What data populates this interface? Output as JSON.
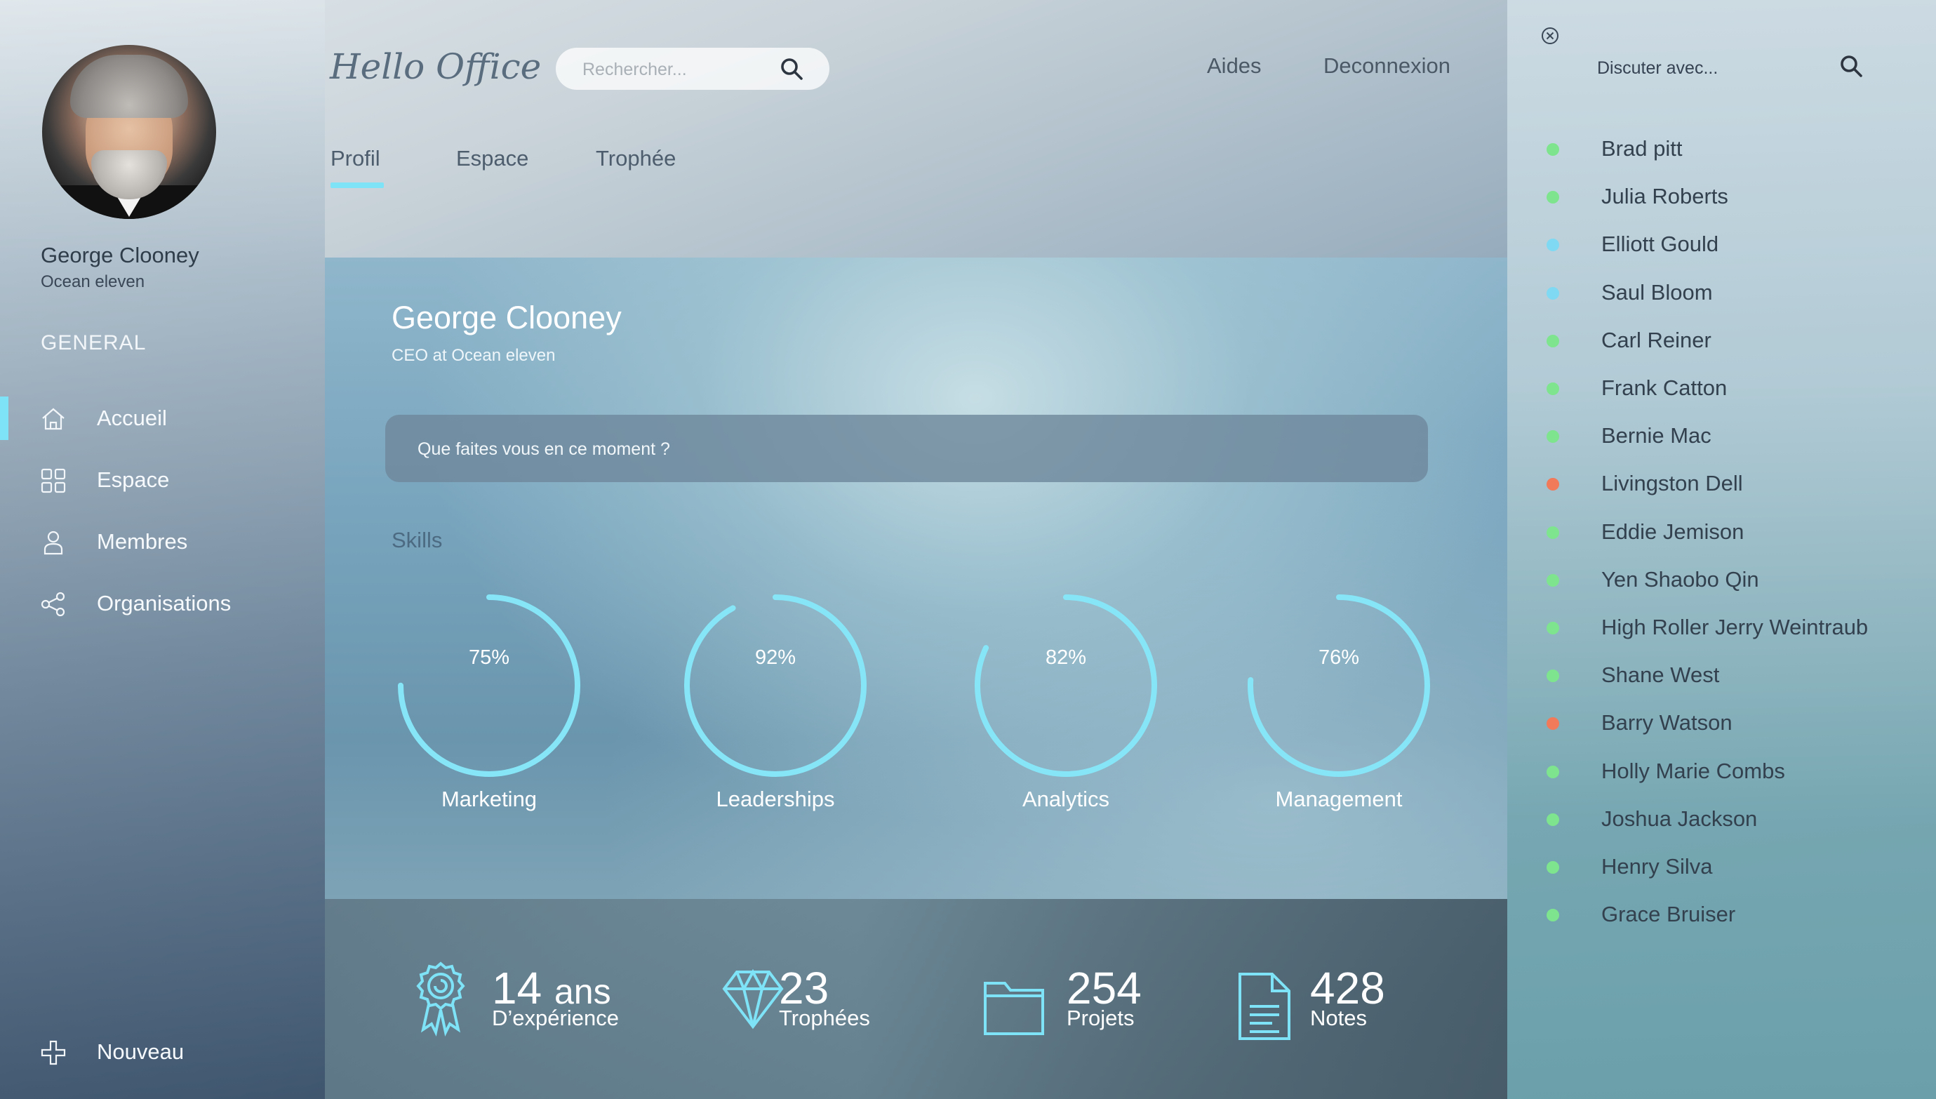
{
  "sidebar": {
    "user_name": "George Clooney",
    "user_sub": "Ocean eleven",
    "section_title": "GENERAL",
    "items": [
      {
        "label": "Accueil",
        "icon": "home-icon"
      },
      {
        "label": "Espace",
        "icon": "grid-icon"
      },
      {
        "label": "Membres",
        "icon": "user-icon"
      },
      {
        "label": "Organisations",
        "icon": "share-icon"
      }
    ],
    "new_label": "Nouveau"
  },
  "header": {
    "logo": "Hello Office",
    "search_placeholder": "Rechercher...",
    "help": "Aides",
    "logout": "Deconnexion",
    "tabs": [
      "Profil",
      "Espace",
      "Trophée"
    ]
  },
  "profile": {
    "name": "George Clooney",
    "role": "CEO at Ocean eleven",
    "status_placeholder": "Que faites vous en ce moment ?",
    "skills_title": "Skills",
    "skills": [
      {
        "name": "Marketing",
        "pct_label": "75%",
        "value": 0.75
      },
      {
        "name": "Leaderships",
        "pct_label": "92%",
        "value": 0.92
      },
      {
        "name": "Analytics",
        "pct_label": "82%",
        "value": 0.82
      },
      {
        "name": "Management",
        "pct_label": "76%",
        "value": 0.76
      }
    ]
  },
  "stats": [
    {
      "number": "14",
      "unit": "ans",
      "label": "D’expérience",
      "icon": "award-icon"
    },
    {
      "number": "23",
      "unit": "",
      "label": "Trophées",
      "icon": "diamond-icon"
    },
    {
      "number": "254",
      "unit": "",
      "label": "Projets",
      "icon": "folder-icon"
    },
    {
      "number": "428",
      "unit": "",
      "label": "Notes",
      "icon": "document-icon"
    }
  ],
  "chat": {
    "search_placeholder": "Discuter avec...",
    "contacts": [
      {
        "name": "Brad pitt",
        "status": "online"
      },
      {
        "name": "Julia Roberts",
        "status": "online"
      },
      {
        "name": "Elliott Gould",
        "status": "away"
      },
      {
        "name": "Saul Bloom",
        "status": "away"
      },
      {
        "name": "Carl Reiner",
        "status": "online"
      },
      {
        "name": "Frank Catton",
        "status": "online"
      },
      {
        "name": "Bernie Mac",
        "status": "online"
      },
      {
        "name": "Livingston Dell",
        "status": "busy"
      },
      {
        "name": "Eddie Jemison",
        "status": "online"
      },
      {
        "name": "Yen  Shaobo Qin",
        "status": "online"
      },
      {
        "name": "High Roller  Jerry Weintraub",
        "status": "online"
      },
      {
        "name": "Shane West",
        "status": "online"
      },
      {
        "name": "Barry Watson",
        "status": "busy"
      },
      {
        "name": "Holly Marie Combs",
        "status": "online"
      },
      {
        "name": "Joshua Jackson",
        "status": "online"
      },
      {
        "name": "Henry Silva",
        "status": "online"
      },
      {
        "name": "Grace Bruiser",
        "status": "online"
      }
    ]
  },
  "colors": {
    "accent": "#7fe3f7",
    "online": "#7ee58e",
    "away": "#7fd9f2",
    "busy": "#f07a5a"
  }
}
